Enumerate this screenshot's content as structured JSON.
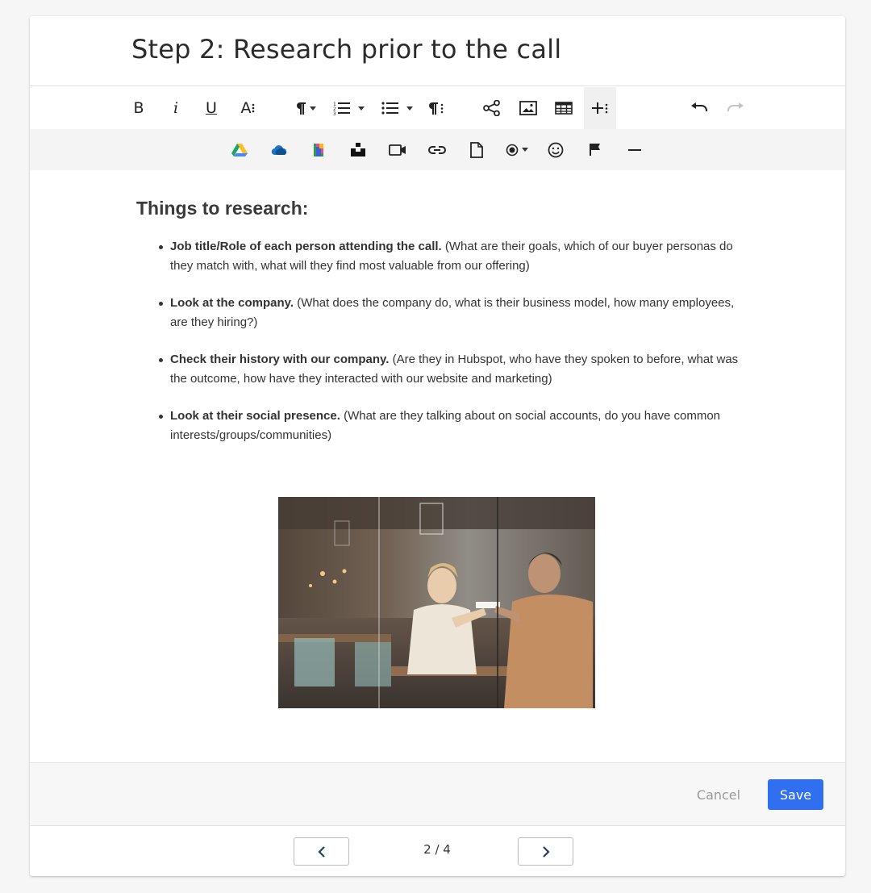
{
  "step": {
    "title": "Step 2: Research prior to the call"
  },
  "toolbar": {
    "bold_label": "B",
    "italic_label": "i",
    "underline_label": "U",
    "font_size_label": "A",
    "row1_icons": [
      "bold-icon",
      "italic-icon",
      "underline-icon",
      "font-size-icon",
      "paragraph-format-icon",
      "ordered-list-icon",
      "unordered-list-icon",
      "paragraph-style-icon",
      "share-icon",
      "insert-image-icon",
      "insert-table-icon",
      "more-insert-icon",
      "undo-icon",
      "redo-icon"
    ],
    "row2_icons": [
      "google-drive-icon",
      "onedrive-icon",
      "box-icon",
      "unsplash-icon",
      "insert-video-icon",
      "insert-link-icon",
      "insert-file-icon",
      "record-icon",
      "emoticon-icon",
      "flag-icon",
      "horizontal-line-icon"
    ]
  },
  "content": {
    "heading": "Things to research:",
    "bullets": [
      {
        "bold": "Job title/Role of each person attending the call.",
        "text": " (What are their goals, which of our buyer personas do they match with, what will they find most valuable from our offering)"
      },
      {
        "bold": "Look at the company.",
        "text": " (What does the company do, what is their business model, how many employees, are they hiring?)"
      },
      {
        "bold": "Check their history with our company.",
        "text": " (Are they in Hubspot, who have they spoken to before, what was the outcome, how have they interacted with our website and marketing)"
      },
      {
        "bold": "Look at their social presence.",
        "text": " (What are they talking about on social accounts, do you have common interests/groups/communities)"
      }
    ]
  },
  "footer": {
    "cancel_label": "Cancel",
    "save_label": "Save"
  },
  "pager": {
    "label": "2 / 4"
  },
  "colors": {
    "accent": "#2f6ff0",
    "toolbar_bg": "#f4f4f5",
    "page_bg": "#f6f6f7"
  }
}
